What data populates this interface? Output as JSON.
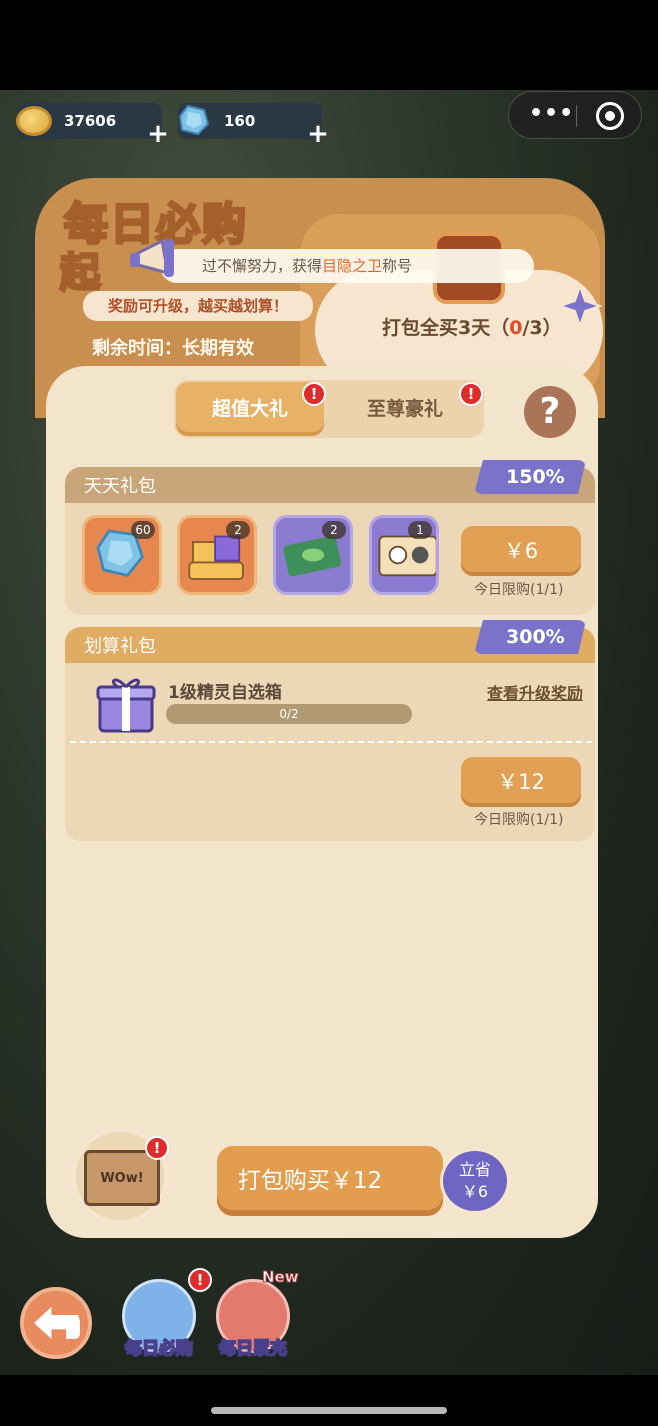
{
  "currency": {
    "coins": "37606",
    "gems": "160"
  },
  "banner": {
    "title_line1": "每日必购",
    "title_line2": "起",
    "subtitle": "奖励可升级，越买越划算！",
    "remaining": "剩余时间：长期有效",
    "toast_prefix": "过不懈努力，获得",
    "toast_highlight": "目隐之卫",
    "toast_suffix": "称号",
    "pack_prefix": "打包全买3天（",
    "pack_progress": "0",
    "pack_suffix": "/3）"
  },
  "tabs": [
    {
      "label": "超值大礼",
      "active": true,
      "badge": "!"
    },
    {
      "label": "至尊豪礼",
      "active": false,
      "badge": "!"
    }
  ],
  "help_icon": "?",
  "daily_pack": {
    "title": "天天礼包",
    "percent": "150%",
    "items": [
      {
        "icon": "blue-gem-icon",
        "count": "60"
      },
      {
        "icon": "gift-pile-icon",
        "count": "2"
      },
      {
        "icon": "green-ticket-icon",
        "count": "2"
      },
      {
        "icon": "pet-card-icon",
        "count": "1"
      }
    ],
    "price": "￥6",
    "limit": "今日限购(1/1)"
  },
  "value_pack": {
    "title": "划算礼包",
    "percent": "300%",
    "item_name": "1级精灵自选箱",
    "progress": "0/2",
    "progress_fraction": 0,
    "upgrade_link": "查看升级奖励",
    "price": "￥12",
    "limit": "今日限购(1/1)"
  },
  "bottom": {
    "wow_label": "WOw!",
    "wow_badge": "!",
    "buy_label": "打包购买￥12",
    "save_line1": "立省",
    "save_line2": "￥6"
  },
  "nav": {
    "daily_label": "每日必购",
    "daily_badge": "!",
    "recharge_label": "每日累充",
    "recharge_badge": "New"
  },
  "colors": {
    "accent_orange": "#e1a054",
    "accent_purple": "#7b72c9",
    "panel_bg": "#f3e4cc",
    "alert_red": "#e02b2b"
  }
}
